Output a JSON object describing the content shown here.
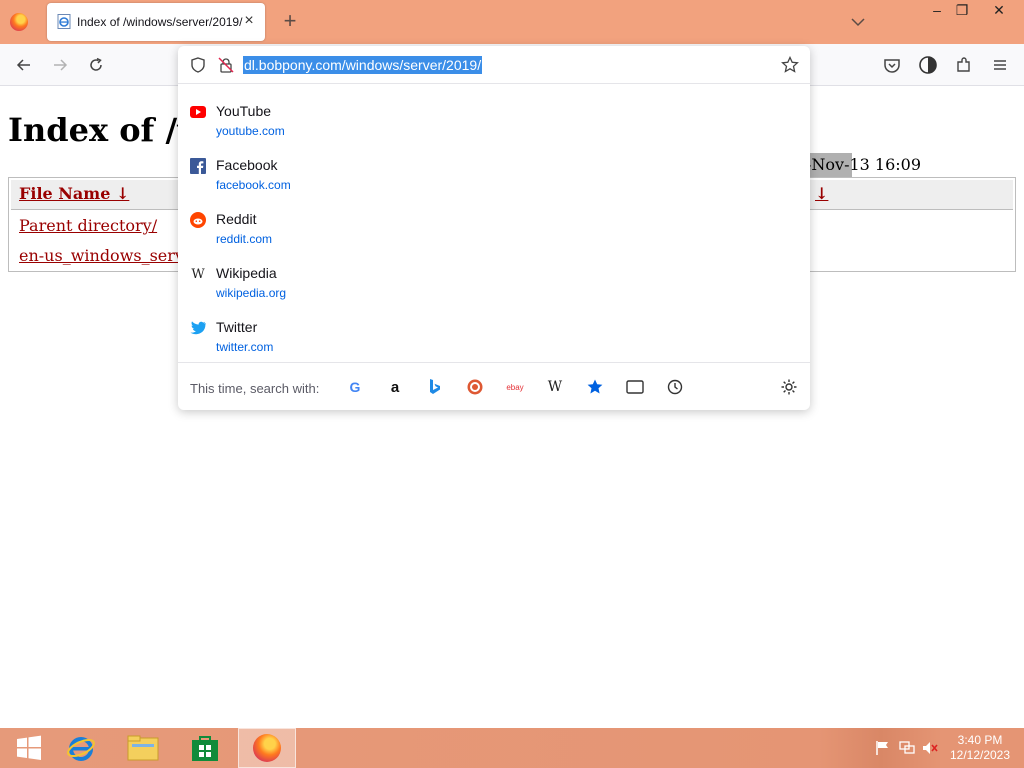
{
  "browser": {
    "tab": {
      "title": "Index of /windows/server/2019/",
      "close_glyph": "×"
    },
    "new_tab_glyph": "+",
    "window_controls": {
      "minimize": "–",
      "restore": "❐",
      "close": "✕"
    },
    "url": "dl.bobpony.com/windows/server/2019/"
  },
  "page": {
    "heading": "Index of /w",
    "table": {
      "col_file_name": "File Name  ↓ ",
      "col_date_arrow": "↓",
      "rows": [
        {
          "name": "Parent directory/"
        },
        {
          "name": "en-us_windows_serv",
          "date_highlight": "-Nov-",
          "date_rest": "13 16:09"
        }
      ]
    }
  },
  "dropdown": {
    "suggestions": [
      {
        "title": "YouTube",
        "url": "youtube.com",
        "icon": "youtube-icon"
      },
      {
        "title": "Facebook",
        "url": "facebook.com",
        "icon": "facebook-icon"
      },
      {
        "title": "Reddit",
        "url": "reddit.com",
        "icon": "reddit-icon"
      },
      {
        "title": "Wikipedia",
        "url": "wikipedia.org",
        "icon": "wikipedia-icon"
      },
      {
        "title": "Twitter",
        "url": "twitter.com",
        "icon": "twitter-icon"
      }
    ],
    "search_label": "This time, search with:",
    "engines": [
      "google-icon",
      "amazon-icon",
      "bing-icon",
      "duckduckgo-icon",
      "ebay-icon",
      "wikipedia-icon",
      "bookmarks-icon",
      "tabs-icon",
      "history-icon"
    ],
    "engine_text": {
      "google": "G",
      "amazon": "a",
      "ebay": "ebay",
      "wikipedia": "W"
    }
  },
  "taskbar": {
    "time": "3:40 PM",
    "date": "12/12/2023"
  },
  "colors": {
    "titlebar": "#f2a27e",
    "taskbar": "#e59574",
    "link": "#990000",
    "url_selection": "#3b8ee8",
    "suggestion_url": "#0061e0"
  }
}
